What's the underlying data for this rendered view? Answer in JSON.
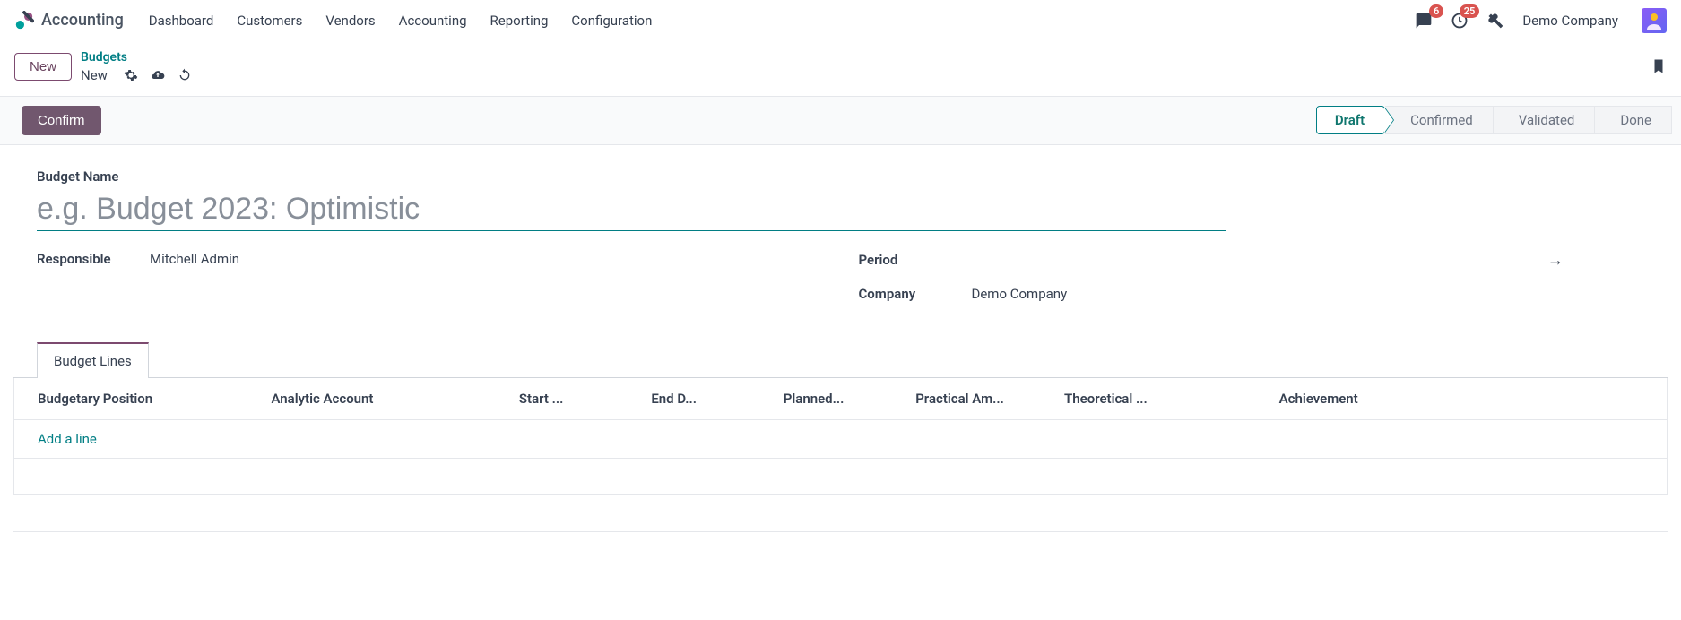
{
  "header": {
    "app_title": "Accounting",
    "nav_items": [
      "Dashboard",
      "Customers",
      "Vendors",
      "Accounting",
      "Reporting",
      "Configuration"
    ],
    "chat_count": "6",
    "activity_count": "25",
    "company": "Demo Company"
  },
  "cp": {
    "new_button": "New",
    "breadcrumb_parent": "Budgets",
    "breadcrumb_current": "New"
  },
  "statusbar": {
    "confirm_button": "Confirm",
    "states": [
      "Draft",
      "Confirmed",
      "Validated",
      "Done"
    ],
    "active_state": "Draft"
  },
  "form": {
    "budget_name_label": "Budget Name",
    "budget_name_placeholder": "e.g. Budget 2023: Optimistic",
    "responsible_label": "Responsible",
    "responsible_value": "Mitchell Admin",
    "period_label": "Period",
    "company_label": "Company",
    "company_value": "Demo Company"
  },
  "tabs": {
    "budget_lines": "Budget Lines"
  },
  "table": {
    "columns": [
      "Budgetary Position",
      "Analytic Account",
      "Start ...",
      "End D...",
      "Planned...",
      "Practical Am...",
      "Theoretical ...",
      "Achievement"
    ],
    "add_line": "Add a line"
  }
}
